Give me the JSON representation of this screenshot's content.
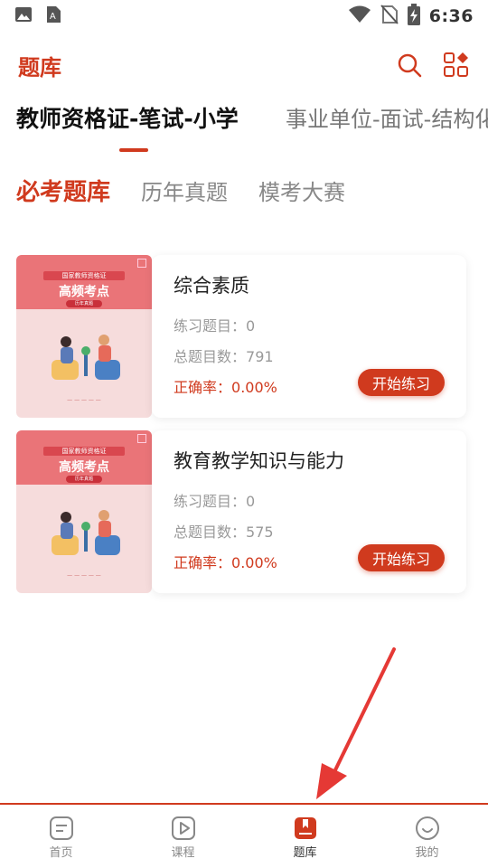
{
  "status_bar": {
    "time": "6:36",
    "icons": [
      "image-icon",
      "text-a-icon",
      "wifi-icon",
      "no-sim-icon",
      "battery-charging-icon"
    ]
  },
  "header": {
    "title": "题库",
    "accent": "#d03a1e",
    "actions": [
      "search-icon",
      "apps-grid-icon"
    ]
  },
  "category_tabs": [
    {
      "label": "教师资格证-笔试-小学",
      "active": true
    },
    {
      "label": "事业单位-面试-结构化",
      "active": false
    }
  ],
  "sub_tabs": [
    {
      "label": "必考题库",
      "active": true
    },
    {
      "label": "历年真题",
      "active": false
    },
    {
      "label": "模考大赛",
      "active": false
    }
  ],
  "cards": [
    {
      "title": "综合素质",
      "practice_label": "练习题目：",
      "practice_value": "0",
      "total_label": "总题目数：",
      "total_value": "791",
      "accuracy_label": "正确率：",
      "accuracy_value": "0.00%",
      "button": "开始练习",
      "cover": {
        "ribbon": "国家教师资格证",
        "headline": "高频考点",
        "pill": "历年真题"
      }
    },
    {
      "title": "教育教学知识与能力",
      "practice_label": "练习题目：",
      "practice_value": "0",
      "total_label": "总题目数：",
      "total_value": "575",
      "accuracy_label": "正确率：",
      "accuracy_value": "0.00%",
      "button": "开始练习",
      "cover": {
        "ribbon": "国家教师资格证",
        "headline": "高频考点",
        "pill": "历年真题"
      }
    }
  ],
  "bottom_nav": [
    {
      "label": "首页",
      "icon": "home-icon",
      "active": false
    },
    {
      "label": "课程",
      "icon": "play-icon",
      "active": false
    },
    {
      "label": "题库",
      "icon": "question-bank-icon",
      "active": true
    },
    {
      "label": "我的",
      "icon": "smile-icon",
      "active": false
    }
  ]
}
